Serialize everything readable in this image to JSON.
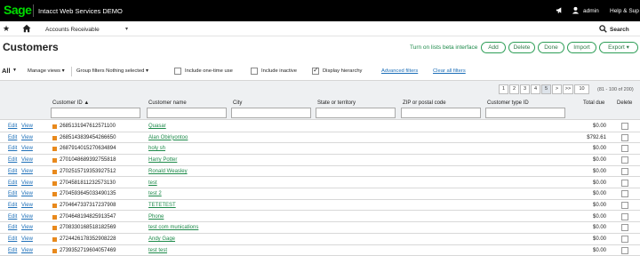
{
  "topbar": {
    "logo": "Sage",
    "app_title": "Intacct  Web Services DEMO",
    "user": "admin",
    "help": "Help & Sup"
  },
  "nav": {
    "module": "Accounts Receivable",
    "search_label": "Search"
  },
  "page": {
    "title": "Customers",
    "beta_link": "Turn on lists beta interface",
    "buttons": {
      "add": "Add",
      "delete": "Delete",
      "done": "Done",
      "import": "Import",
      "export": "Export"
    }
  },
  "filters": {
    "view": "All",
    "manage_views": "Manage views",
    "group_filters": "Group filters Nothing selected",
    "include_one_time": "Include one-time use",
    "include_inactive": "Include inactive",
    "display_hierarchy": "Display hierarchy",
    "display_hierarchy_checked": true,
    "advanced_filters": "Advanced filters",
    "clear_all": "Clear all filters"
  },
  "pagination": {
    "pages": [
      "1",
      "2",
      "3",
      "4",
      "5",
      ">",
      ">>",
      "10"
    ],
    "current": "5",
    "range": "(81 - 100 of 200)"
  },
  "table": {
    "columns": {
      "customer_id": "Customer ID",
      "customer_name": "Customer name",
      "city": "City",
      "state": "State or territory",
      "zip": "ZIP or postal code",
      "type": "Customer type ID",
      "total_due": "Total due",
      "delete": "Delete"
    },
    "edit_label": "Edit",
    "view_label": "View",
    "rows": [
      {
        "id": "2685131947612571100",
        "name": "Quasar",
        "due": "$0.00"
      },
      {
        "id": "2685143839454266650",
        "name": "Alan Obiriyontoo",
        "due": "$792.61"
      },
      {
        "id": "2687914015270634894",
        "name": "holy sh",
        "due": "$0.00"
      },
      {
        "id": "2701048689392755818",
        "name": "Harry Potter",
        "due": "$0.00"
      },
      {
        "id": "2702515719353927512",
        "name": "Ronald Weasley",
        "due": "$0.00"
      },
      {
        "id": "2704581811232573130",
        "name": "test",
        "due": "$0.00"
      },
      {
        "id": "2704593645033490135",
        "name": "test 2",
        "due": "$0.00"
      },
      {
        "id": "2704647337317237908",
        "name": "TETETEST",
        "due": "$0.00"
      },
      {
        "id": "2704648194825913547",
        "name": "Phone",
        "due": "$0.00"
      },
      {
        "id": "2708330168518182569",
        "name": "test com munications",
        "due": "$0.00"
      },
      {
        "id": "2724426178352908228",
        "name": "Andy Gage",
        "due": "$0.00"
      },
      {
        "id": "2739352719604057469",
        "name": "test test",
        "due": "$0.00"
      }
    ]
  }
}
